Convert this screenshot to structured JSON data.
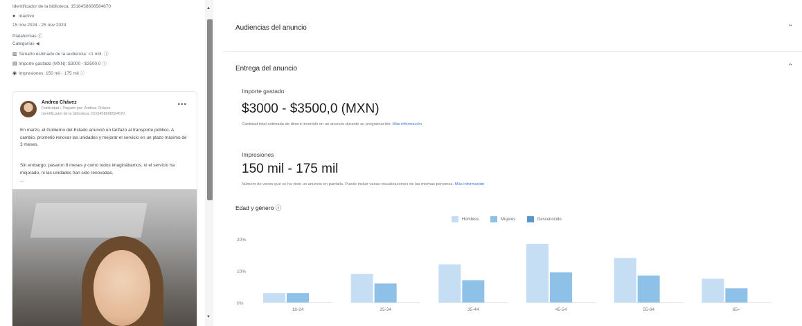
{
  "library": {
    "id_line": "Identificador de la biblioteca: 1516458608584670",
    "status": "Inactivo",
    "date_range": "15 nov 2024 - 25 nov 2024",
    "platforms_label": "Plataformas",
    "categories_label": "Categorías",
    "audience_size": "Tamaño estimado de la audiencia: <1 mill.",
    "amount_spent": "Importe gastado (MXN): $3000 - $3500,0",
    "impressions": "Impresiones: 150 mil - 175 mil"
  },
  "ad": {
    "advertiser": "Andrea Chávez",
    "subtitle": "Publicidad • Pagado por: Andrea Chávez",
    "library_id": "Identificador de la biblioteca: 1516458608584670",
    "more_label": "•••",
    "paragraph1": "En marzo, el Gobierno del Estado anunció un tarifazo al transporte público. A cambio, prometió renovar las unidades y mejorar el servicio en un plazo máximo de 3 meses.",
    "paragraph2": "Sin embargo, pasaron 8 meses y como todos imaginábamos, ni el servicio ha mejorado, ni las unidades han sido renovadas.",
    "ellipsis": "..."
  },
  "scrollbar": {
    "up": "▲",
    "down": "▼"
  },
  "sections": {
    "audiences": {
      "title": "Audiencias del anuncio",
      "chevron": "⌄"
    },
    "delivery": {
      "title": "Entrega del anuncio",
      "chevron": "⌃"
    }
  },
  "delivery": {
    "spent_label": "Importe gastado",
    "spent_value": "$3000 - $3500,0 (MXN)",
    "spent_desc": "Cantidad total estimada de dinero invertido en un anuncio durante su programación.",
    "impressions_label": "Impresiones",
    "impressions_value": "150 mil - 175 mil",
    "impressions_desc": "Número de veces que se ha visto un anuncio en pantalla. Puede incluir varias visualizaciones de las mismas personas.",
    "more_info": "Más información"
  },
  "age_gender": {
    "title": "Edad y género",
    "info_icon": "info-icon"
  },
  "colors": {
    "hombres": "#c5def4",
    "mujeres": "#8ec1e8",
    "desconocido": "#5a98cc",
    "link": "#3b7be0"
  },
  "chart_data": {
    "type": "bar",
    "categories": [
      "18-24",
      "25-34",
      "35-44",
      "45-54",
      "55-64",
      "65+"
    ],
    "series": [
      {
        "name": "Hombres",
        "values": [
          3,
          9,
          12,
          18.5,
          14,
          7.5
        ]
      },
      {
        "name": "Mujeres",
        "values": [
          3,
          6,
          7,
          9.5,
          8.5,
          4.5
        ]
      },
      {
        "name": "Desconocido",
        "values": [
          0,
          0,
          0,
          0,
          0,
          0
        ]
      }
    ],
    "yticks": [
      "0%",
      "10%",
      "20%"
    ],
    "ylim": [
      0,
      20
    ],
    "legend": "top-center",
    "grid": false
  }
}
